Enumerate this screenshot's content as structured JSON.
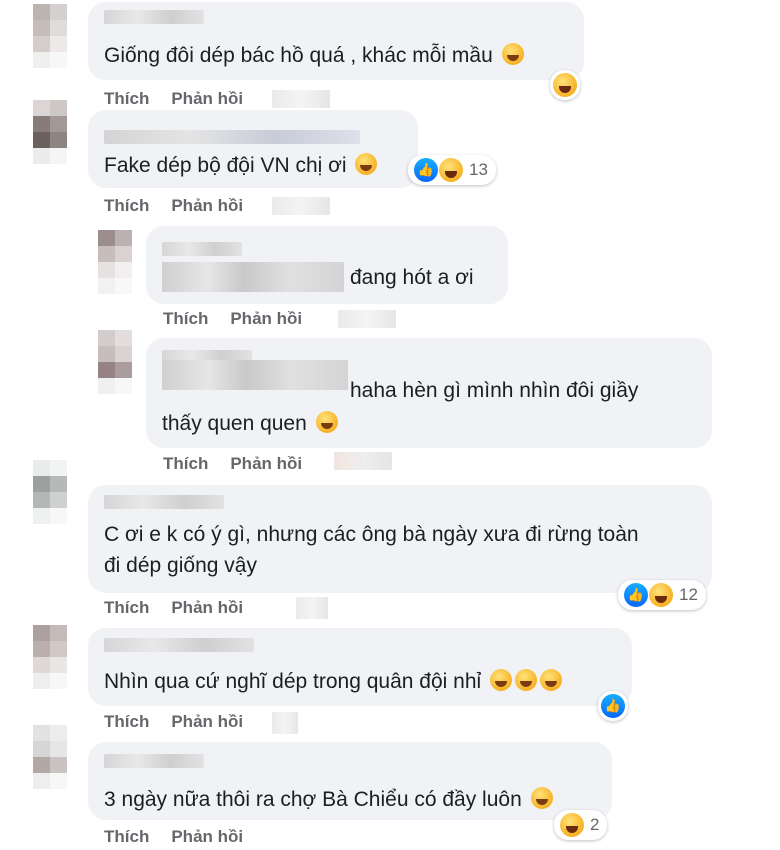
{
  "actions": {
    "like": "Thích",
    "reply": "Phản hồi"
  },
  "comments": [
    {
      "text": "Giống đôi dép bác hồ quá , khác mỗi mầu",
      "emoji": "smiling-face",
      "reactions": [
        "haha"
      ],
      "count": ""
    },
    {
      "text": "Fake dép bộ đội VN chị ơi",
      "emoji": "rofl-face",
      "reactions": [
        "like",
        "haha"
      ],
      "count": "13"
    },
    {
      "text": "đang hót a ơi",
      "emoji": "",
      "reactions": [],
      "count": ""
    },
    {
      "text": "haha hèn gì mình nhìn đôi giầy",
      "text2": "thấy quen quen",
      "emoji": "tears-of-joy-face",
      "reactions": [],
      "count": ""
    },
    {
      "text": "C ơi e k có ý gì, nhưng các ông bà ngày xưa đi rừng toàn",
      "text2": "đi dép giống vậy",
      "emoji": "",
      "reactions": [
        "like",
        "haha"
      ],
      "count": "12"
    },
    {
      "text": "Nhìn qua cứ nghĩ dép trong quân đội nhỉ",
      "emoji": "rofl-face x3",
      "reactions": [
        "like"
      ],
      "count": ""
    },
    {
      "text": "3 ngày nữa thôi ra chợ Bà Chiểu có đầy luôn",
      "emoji": "grinning-face",
      "reactions": [
        "haha"
      ],
      "count": "2"
    }
  ],
  "colors": {
    "bubble": "#f0f2f5",
    "action": "#65676b",
    "like": "#0866ff",
    "haha": "#f7b125"
  }
}
